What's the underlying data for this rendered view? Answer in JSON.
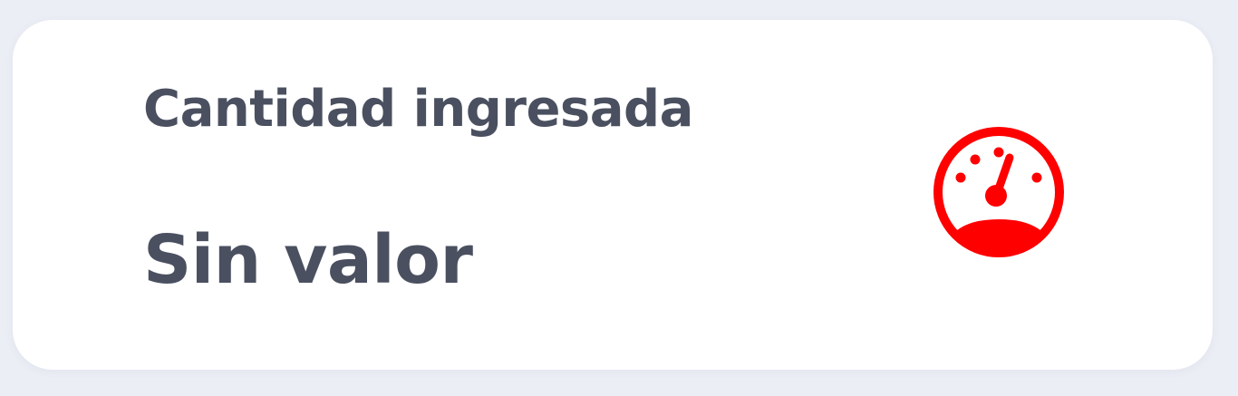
{
  "card": {
    "label": "Cantidad ingresada",
    "value": "Sin valor",
    "icon": "speedometer-icon",
    "icon_color": "#ff0000",
    "text_color": "#4a5060",
    "background": "#ffffff",
    "page_background": "#eceef6"
  }
}
